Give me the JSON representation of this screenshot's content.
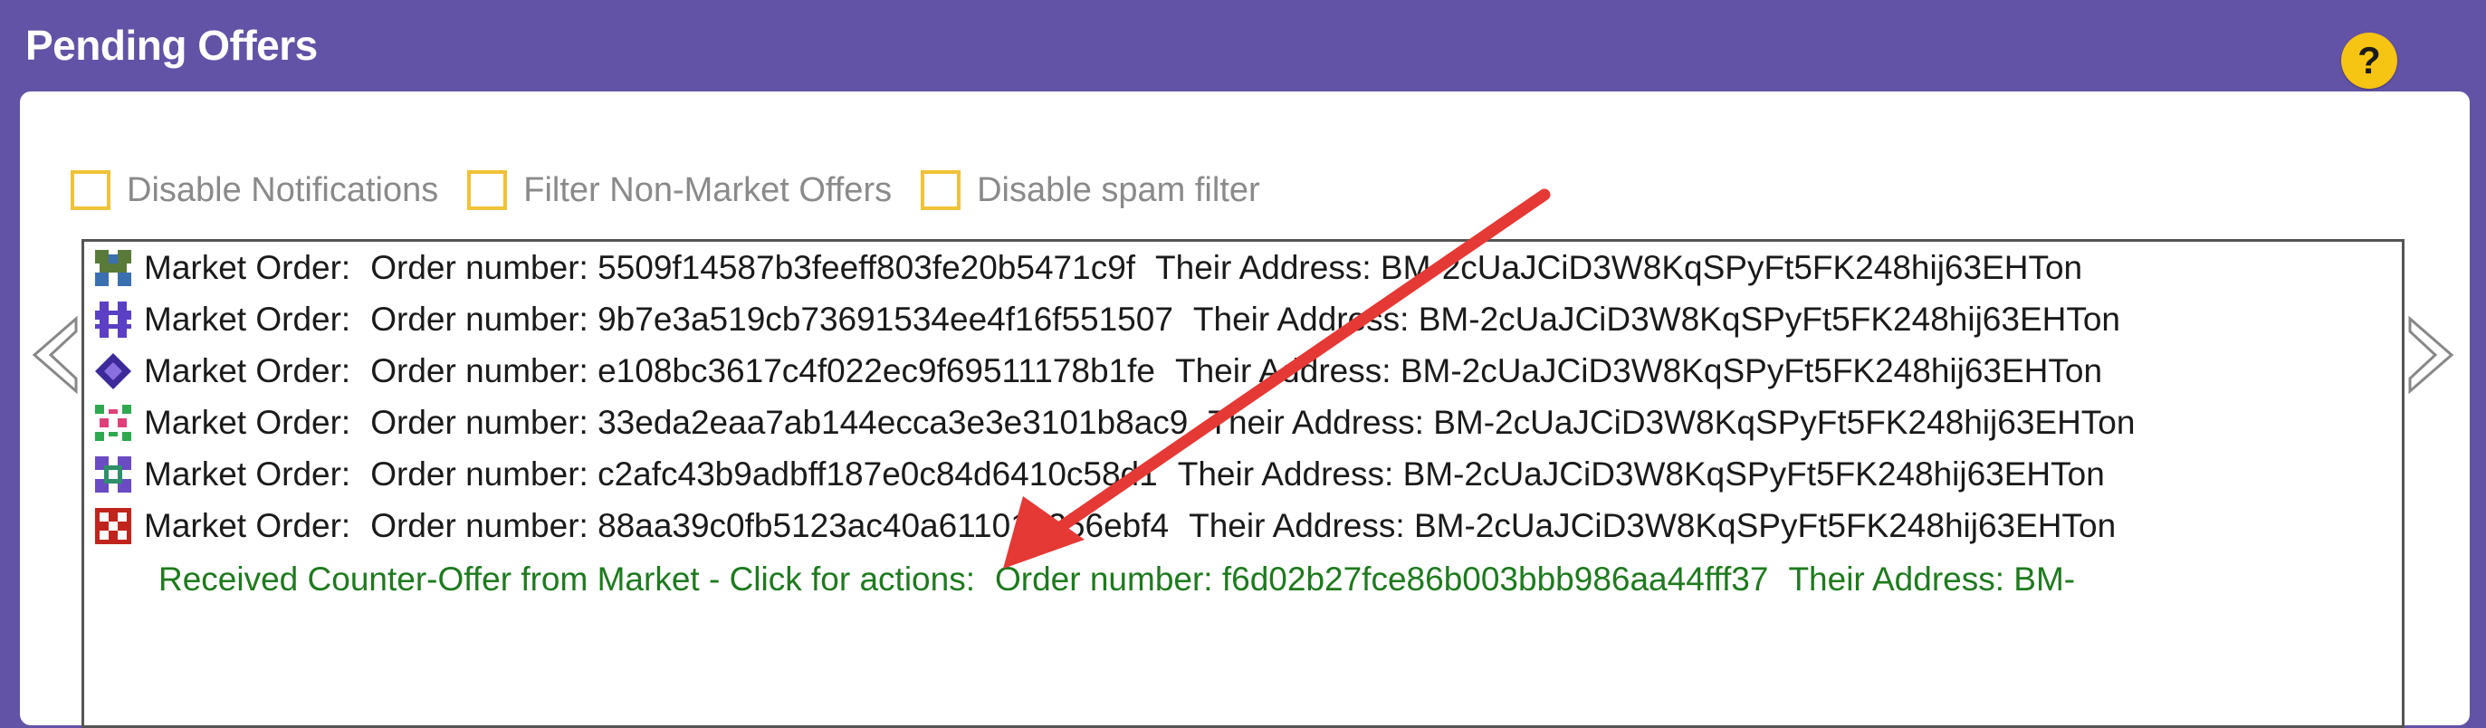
{
  "header": {
    "title": "Pending Offers",
    "help_label": "?"
  },
  "options": [
    {
      "label": "Disable Notifications",
      "checked": false
    },
    {
      "label": "Filter Non-Market Offers",
      "checked": false
    },
    {
      "label": "Disable spam filter",
      "checked": false
    }
  ],
  "offers": [
    {
      "type": "Market Order:",
      "order_label": "Order number:",
      "order_number": "5509f14587b3feeff803fe20b5471c9f",
      "address_label": "Their Address:",
      "address": "BM-2cUaJCiD3W8KqSPyFt5FK248hij63EHTon"
    },
    {
      "type": "Market Order:",
      "order_label": "Order number:",
      "order_number": "9b7e3a519cb73691534ee4f16f551507",
      "address_label": "Their Address:",
      "address": "BM-2cUaJCiD3W8KqSPyFt5FK248hij63EHTon"
    },
    {
      "type": "Market Order:",
      "order_label": "Order number:",
      "order_number": "e108bc3617c4f022ec9f69511178b1fe",
      "address_label": "Their Address:",
      "address": "BM-2cUaJCiD3W8KqSPyFt5FK248hij63EHTon"
    },
    {
      "type": "Market Order:",
      "order_label": "Order number:",
      "order_number": "33eda2eaa7ab144ecca3e3e3101b8ac9",
      "address_label": "Their Address:",
      "address": "BM-2cUaJCiD3W8KqSPyFt5FK248hij63EHTon"
    },
    {
      "type": "Market Order:",
      "order_label": "Order number:",
      "order_number": "c2afc43b9adbff187e0c84d6410c58d1",
      "address_label": "Their Address:",
      "address": "BM-2cUaJCiD3W8KqSPyFt5FK248hij63EHTon"
    },
    {
      "type": "Market Order:",
      "order_label": "Order number:",
      "order_number": "88aa39c0fb5123ac40a611018256ebf4",
      "address_label": "Their Address:",
      "address": "BM-2cUaJCiD3W8KqSPyFt5FK248hij63EHTon"
    }
  ],
  "counter_offer": {
    "text": "Received Counter-Offer from Market - Click for actions:",
    "order_label": "Order number:",
    "order_number": "f6d02b27fce86b003bbb986aa44fff37",
    "address_label": "Their Address:",
    "address": "BM-"
  },
  "colors": {
    "header_bg": "#6353a6",
    "help_button": "#f6c412",
    "checkbox_border": "#f0c238",
    "counter_offer_text": "#1e7a1e",
    "annotation_arrow": "#e53935"
  },
  "icons": {
    "help": "question-icon",
    "nav_left": "chevron-left-icon",
    "nav_right": "chevron-right-icon",
    "offer_identicons": [
      "identicon-1",
      "identicon-2",
      "identicon-3",
      "identicon-4",
      "identicon-5",
      "identicon-6"
    ]
  }
}
